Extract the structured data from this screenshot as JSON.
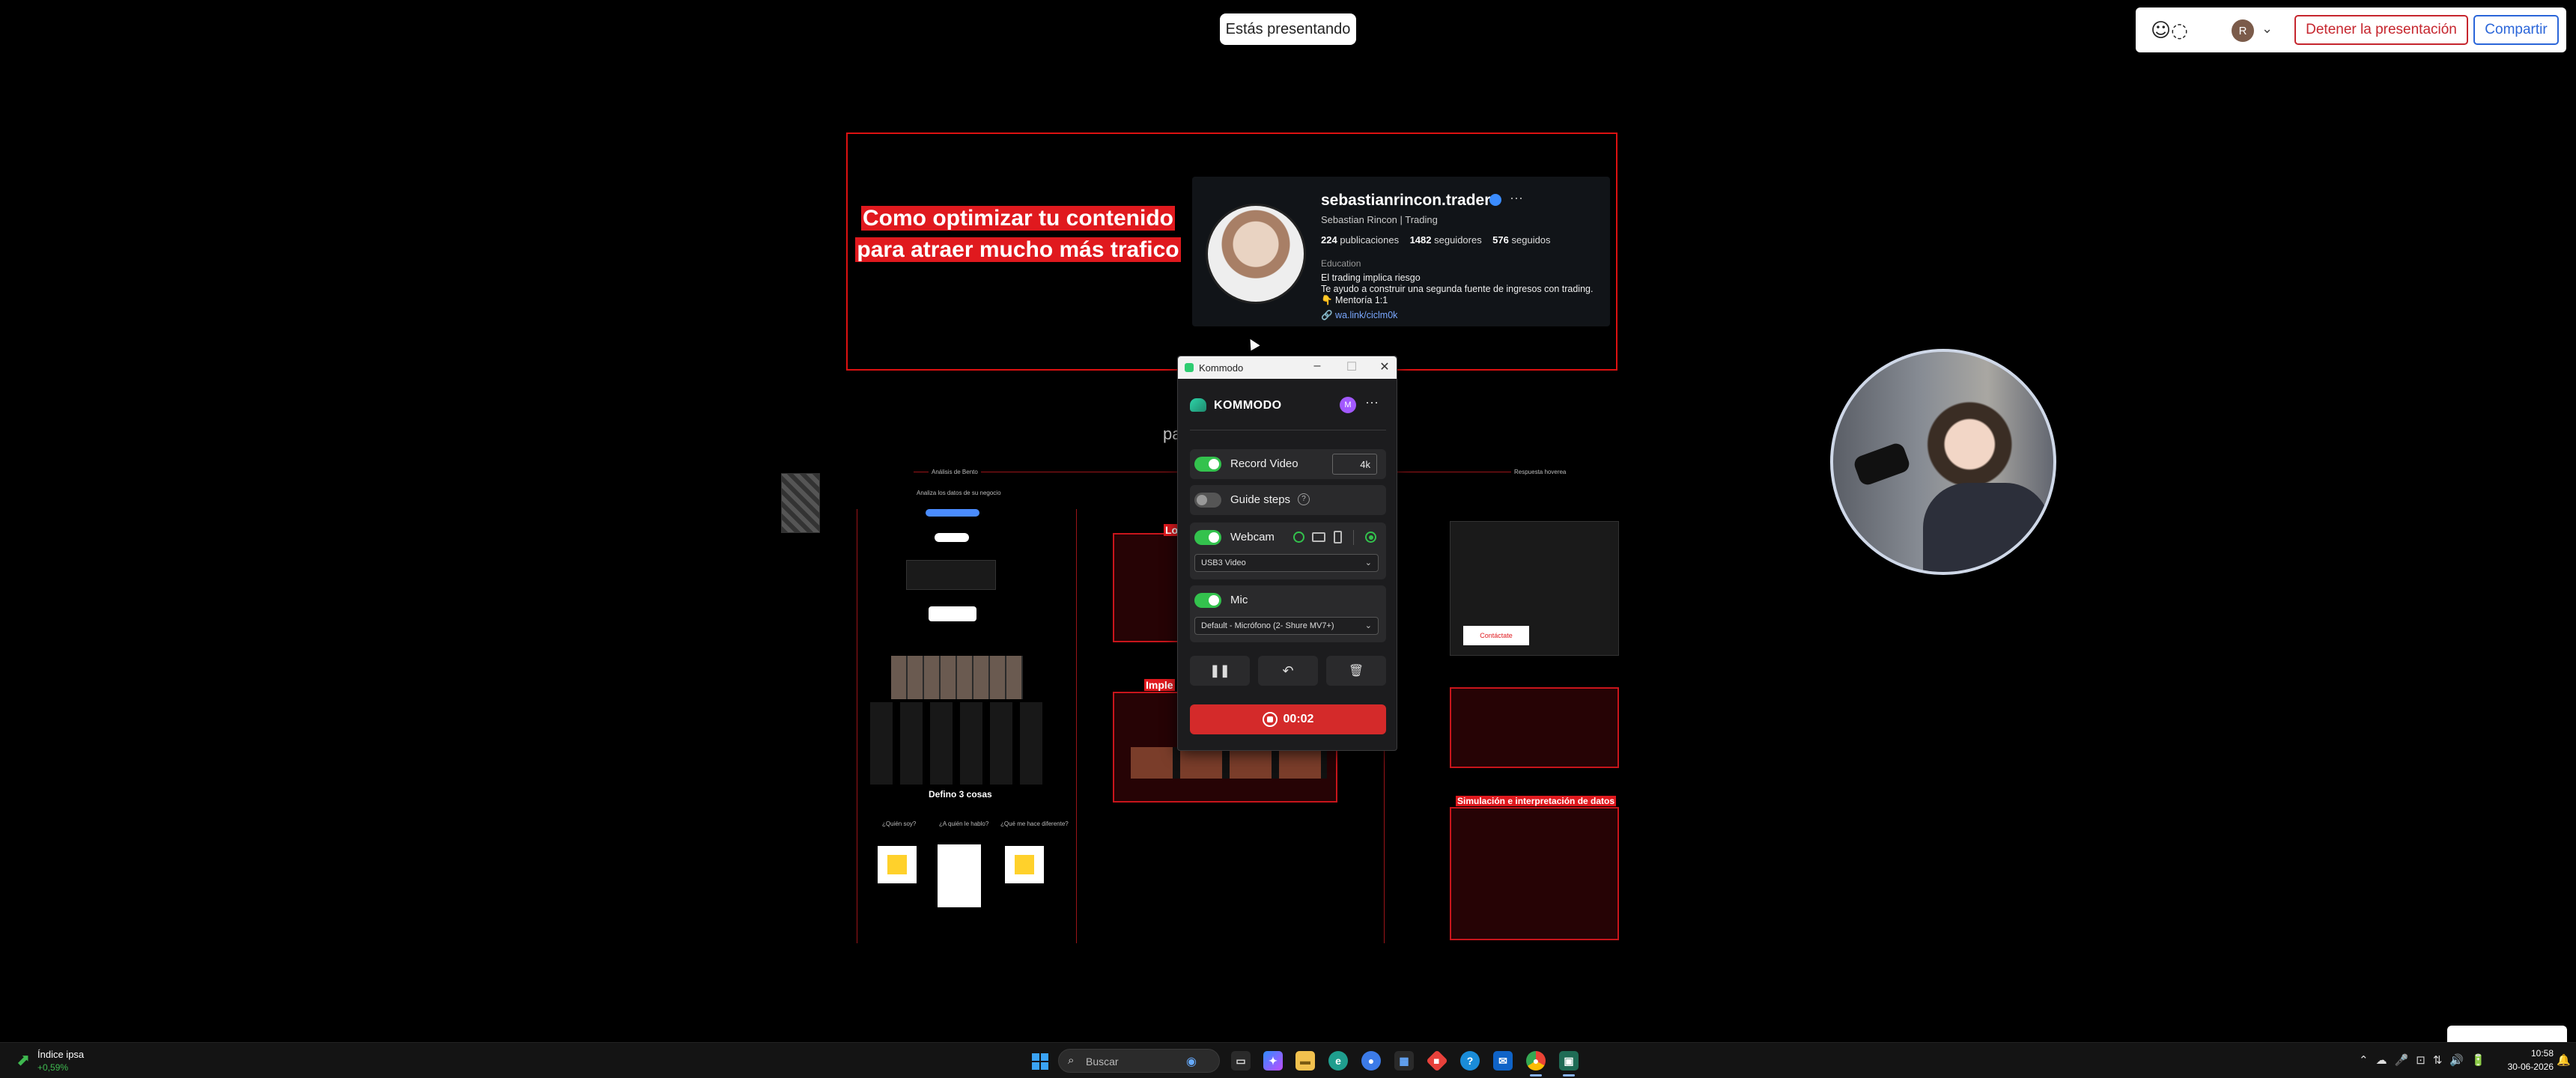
{
  "presenting_banner": "Estás presentando",
  "sharebar": {
    "emoji_icon": "emoji-ring-icon",
    "avatar_letter": "R",
    "stop_label": "Detener la presentación",
    "share_label": "Compartir",
    "stop_color": "#c6262e",
    "share_color": "#2b66d9"
  },
  "slide": {
    "title": "Como optimizar tu contenido para atraer mucho más trafico",
    "title_color": "#e0191e",
    "partial_text": "pa"
  },
  "instagram": {
    "username": "sebastianrincon.trader",
    "more": "···",
    "fullname": "Sebastian Rincon | Trading",
    "posts": "224",
    "posts_label": "publicaciones",
    "followers": "1482",
    "followers_label": "seguidores",
    "following": "576",
    "following_label": "seguidos",
    "category": "Education",
    "bio_lines": [
      "El trading implica riesgo",
      "Te ayudo a construir una segunda fuente de ingresos con trading.",
      "👇 Mentoría 1:1"
    ],
    "link": "wa.link/ciclm0k"
  },
  "board": {
    "header_left": "Análisis de Bento",
    "header_right": "Respuesta hoverea",
    "col1_caption": "Analiza los datos de su negocio",
    "defino": "Defino 3 cosas",
    "defino_items": [
      "¿Quién soy?",
      "¿A quién le hablo?",
      "¿Qué me hace diferente?"
    ],
    "red_lbl_lo": "Lo",
    "red_lbl_imple": "Imple",
    "simulation_label": "Simulación e interpretación de datos",
    "email_btn": "Contáctate"
  },
  "kommodo": {
    "window_title": "Kommodo",
    "brand": "KOMMODO",
    "avatar_letter": "M",
    "record_video_label": "Record Video",
    "record_video_on": true,
    "quality": "4k",
    "guide_steps_label": "Guide steps",
    "guide_steps_on": false,
    "webcam_label": "Webcam",
    "webcam_on": true,
    "webcam_device": "USB3 Video",
    "mic_label": "Mic",
    "mic_on": true,
    "mic_device": "Default - Micrófono (2- Shure MV7+)",
    "timer": "00:02",
    "rec_color": "#d42a2a",
    "toggle_on_color": "#33c24d"
  },
  "taskbar": {
    "weather_name": "Índice ipsa",
    "weather_value": "+0,59%",
    "search_placeholder": "Buscar",
    "time": "10:58",
    "date": "30-06-2026"
  }
}
